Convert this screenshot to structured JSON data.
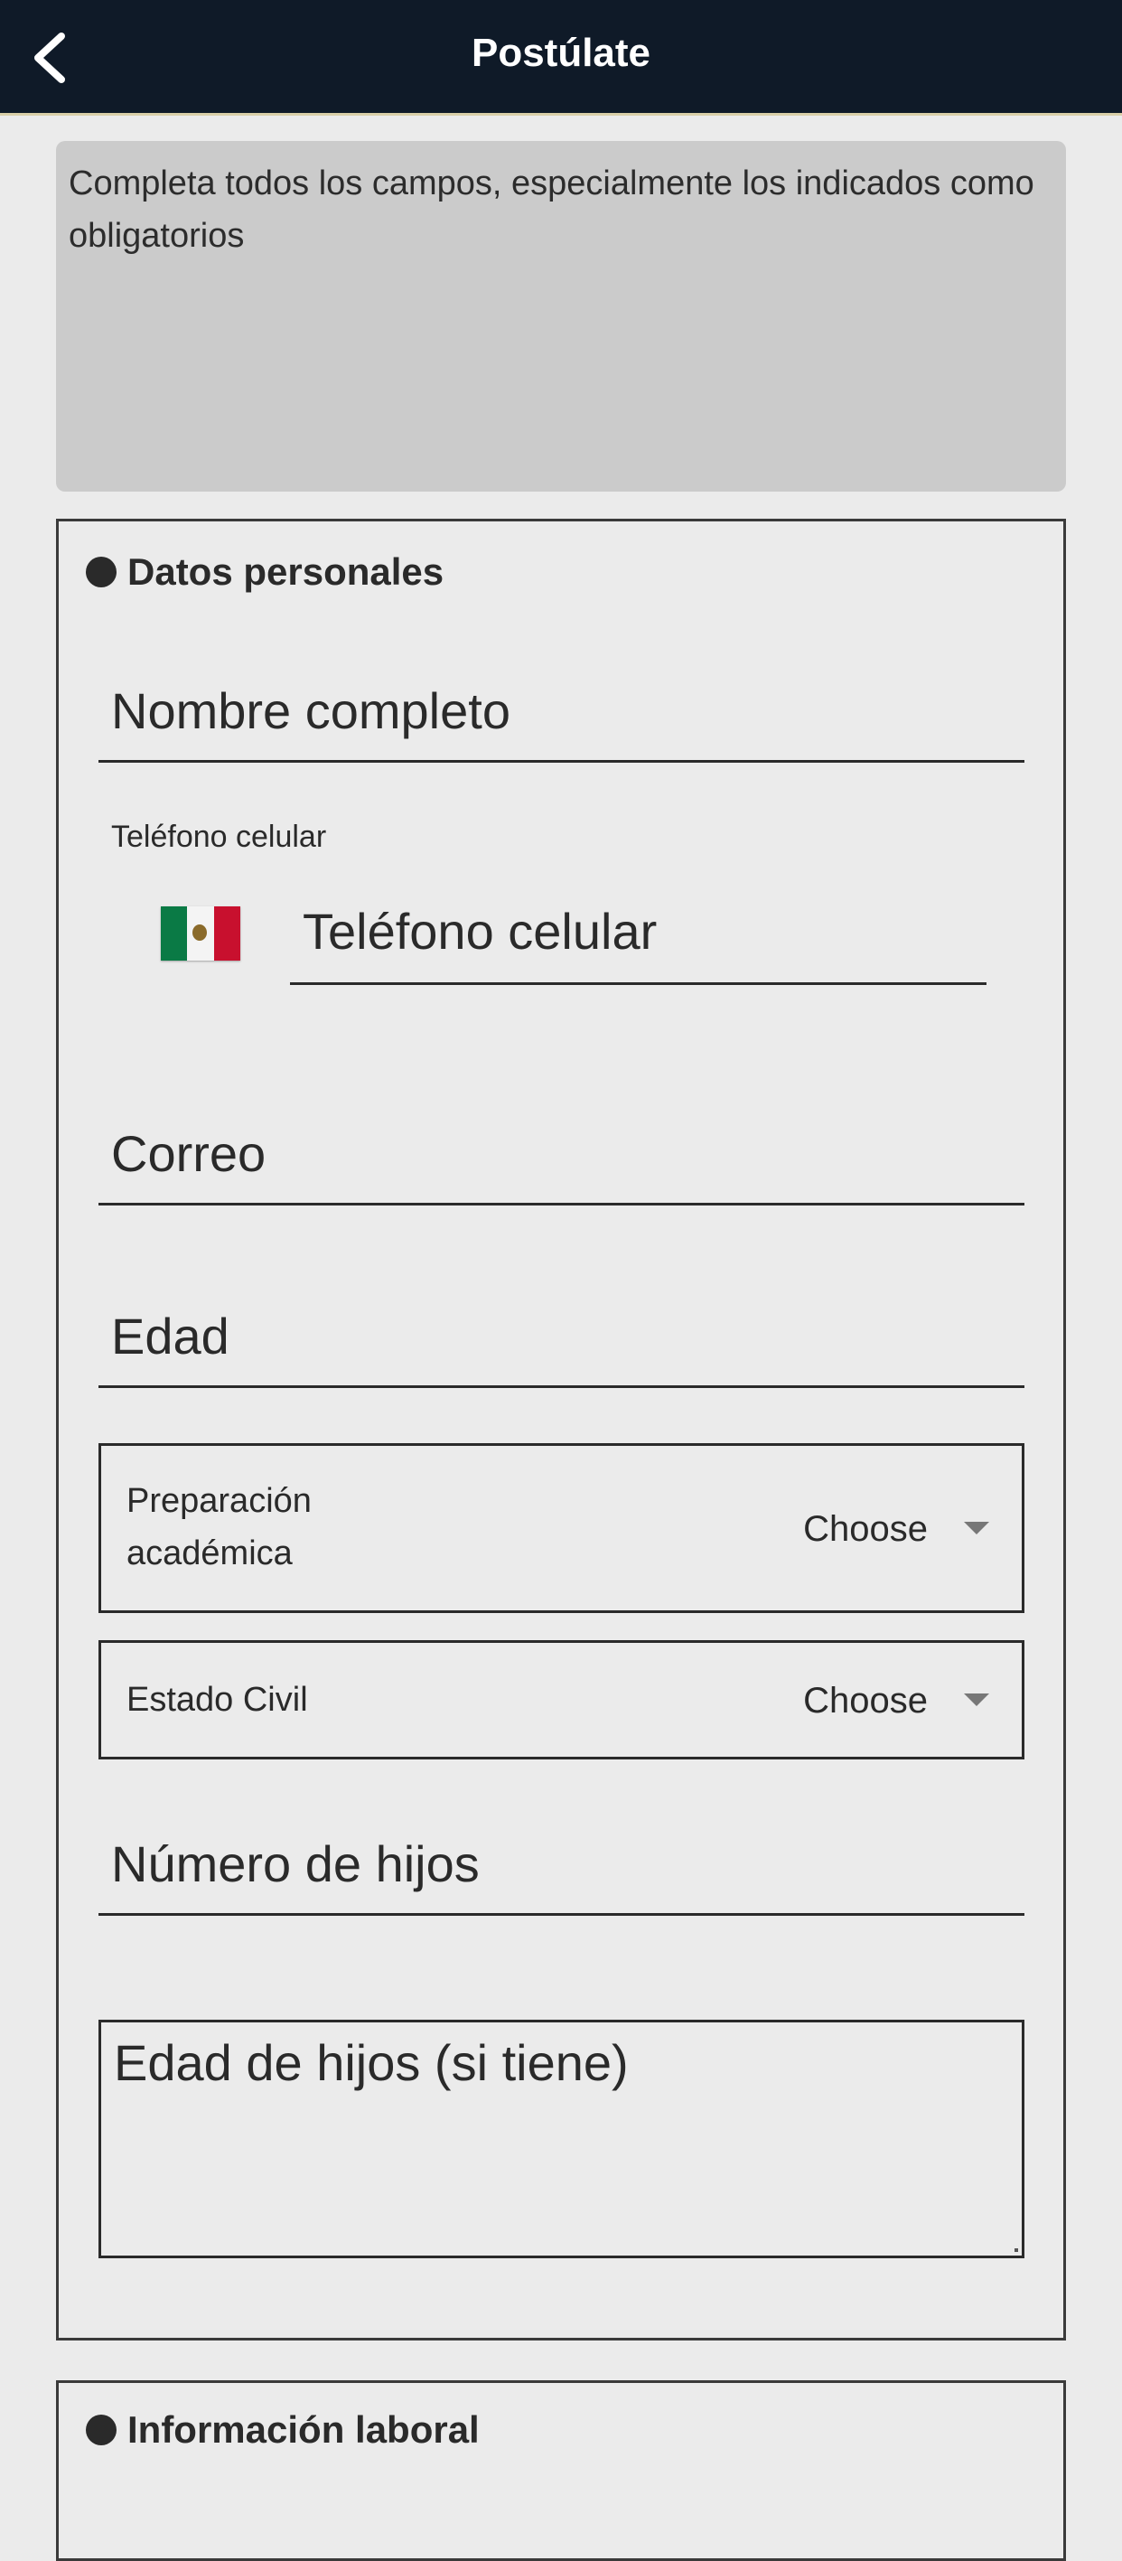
{
  "header": {
    "title": "Postúlate",
    "back_icon": "chevron-left-icon"
  },
  "notice": {
    "text": "Completa todos los campos, especialmente los indicados como obligatorios"
  },
  "personal_section": {
    "title": "Datos personales",
    "full_name_placeholder": "Nombre completo",
    "phone_label": "Teléfono celular",
    "phone_country_flag": "mexico-flag-icon",
    "phone_placeholder": "Teléfono celular",
    "email_placeholder": "Correo",
    "age_placeholder": "Edad",
    "education": {
      "label": "Preparación académica",
      "value": "Choose"
    },
    "marital_status": {
      "label": "Estado Civil",
      "value": "Choose"
    },
    "children_count_placeholder": "Número de hijos",
    "children_ages_placeholder": "Edad de hijos (si tiene)"
  },
  "work_section": {
    "title": "Información laboral"
  },
  "colors": {
    "header_bg": "#0f1a28",
    "page_bg": "#ebebeb",
    "notice_bg": "#cbcbcb",
    "text": "#2a2a2a"
  }
}
